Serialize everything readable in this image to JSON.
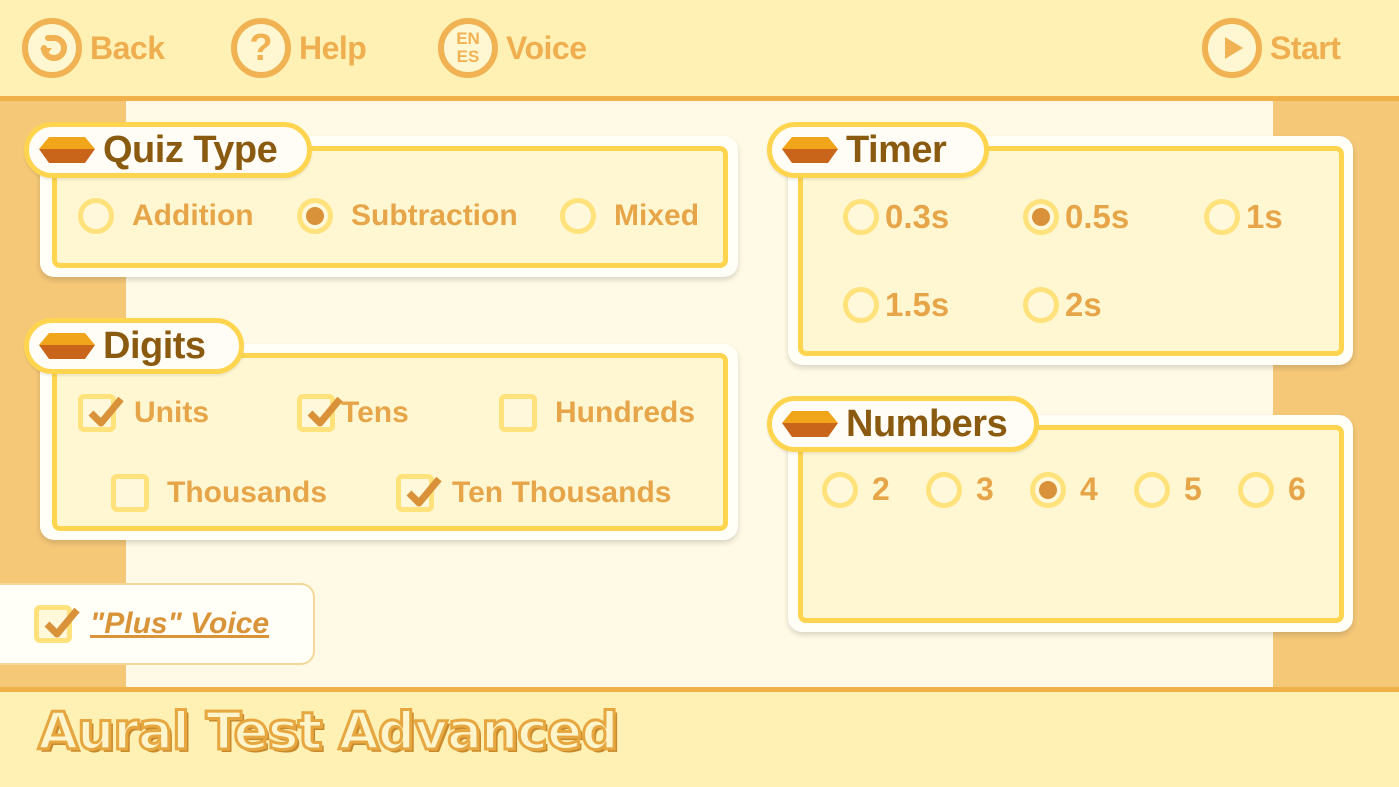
{
  "toolbar": {
    "back_label": "Back",
    "help_label": "Help",
    "voice_label": "Voice",
    "voice_icon_top": "EN",
    "voice_icon_bottom": "ES",
    "start_label": "Start"
  },
  "quiz_type": {
    "title": "Quiz Type",
    "options": [
      {
        "label": "Addition",
        "selected": false
      },
      {
        "label": "Subtraction",
        "selected": true
      },
      {
        "label": "Mixed",
        "selected": false
      }
    ]
  },
  "digits": {
    "title": "Digits",
    "options": [
      {
        "label": "Units",
        "checked": true
      },
      {
        "label": "Tens",
        "checked": true
      },
      {
        "label": "Hundreds",
        "checked": false
      },
      {
        "label": "Thousands",
        "checked": false
      },
      {
        "label": "Ten Thousands",
        "checked": true
      }
    ]
  },
  "timer": {
    "title": "Timer",
    "options": [
      {
        "label": "0.3s",
        "selected": false
      },
      {
        "label": "0.5s",
        "selected": true
      },
      {
        "label": "1s",
        "selected": false
      },
      {
        "label": "1.5s",
        "selected": false
      },
      {
        "label": "2s",
        "selected": false
      }
    ]
  },
  "numbers": {
    "title": "Numbers",
    "options": [
      {
        "label": "2",
        "selected": false
      },
      {
        "label": "3",
        "selected": false
      },
      {
        "label": "4",
        "selected": true
      },
      {
        "label": "5",
        "selected": false
      },
      {
        "label": "6",
        "selected": false
      }
    ]
  },
  "plus_voice": {
    "label": "\"Plus\" Voice",
    "checked": true
  },
  "footer": {
    "title": "Aural Test Advanced"
  },
  "colors": {
    "accent": "#f1b253",
    "panel_border": "#ffd54f",
    "selected_dot": "#d9913a",
    "header_text": "#8a5a10",
    "option_text": "#e7a549"
  }
}
